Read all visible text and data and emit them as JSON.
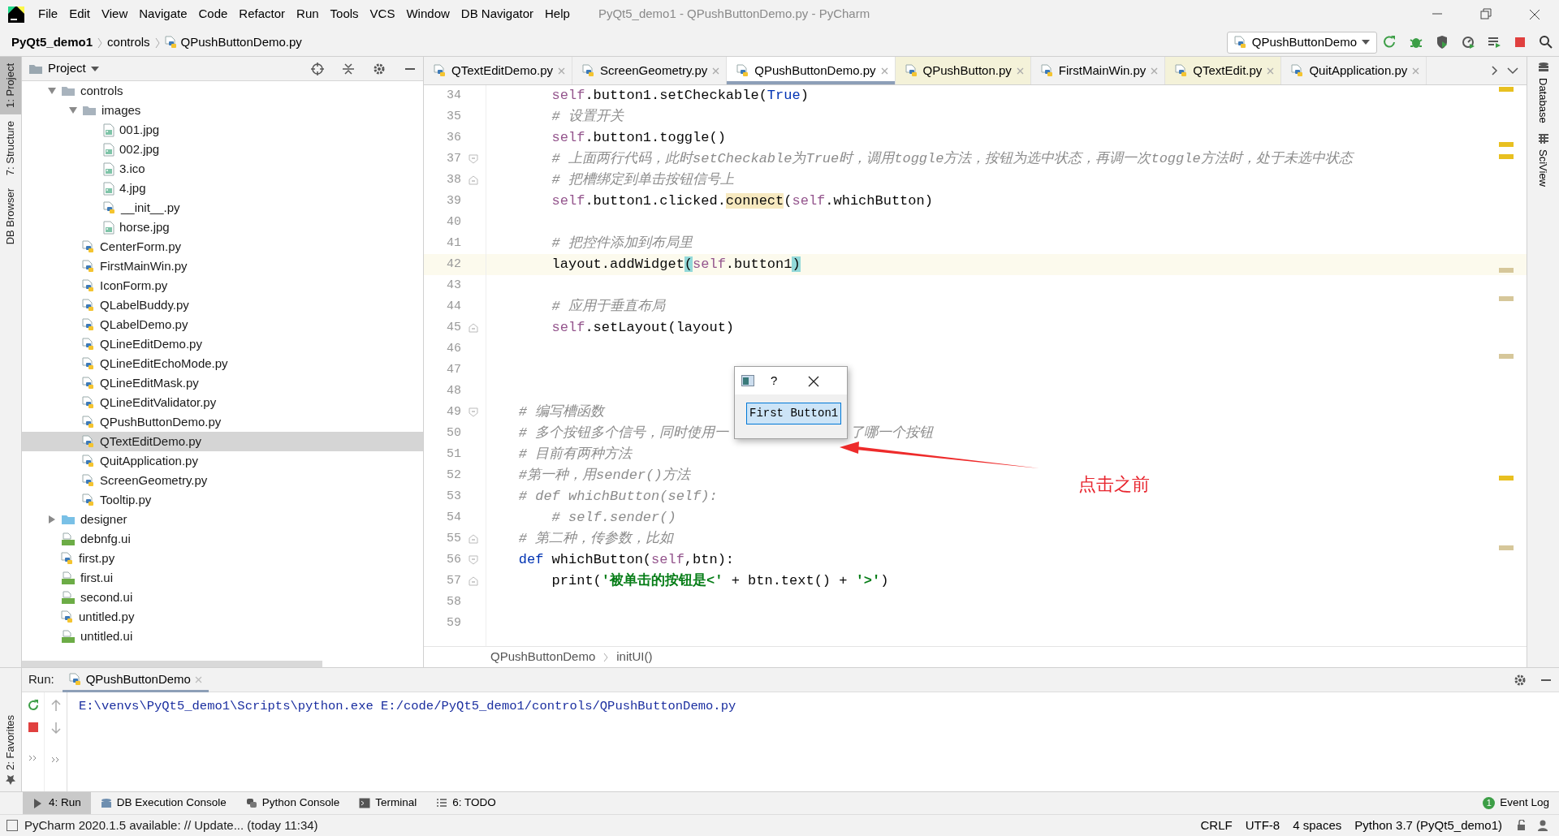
{
  "app_title": "PyQt5_demo1 - QPushButtonDemo.py - PyCharm",
  "menu": [
    "File",
    "Edit",
    "View",
    "Navigate",
    "Code",
    "Refactor",
    "Run",
    "Tools",
    "VCS",
    "Window",
    "DB Navigator",
    "Help"
  ],
  "breadcrumb": [
    "PyQt5_demo1",
    "controls",
    "QPushButtonDemo.py"
  ],
  "run_config": "QPushButtonDemo",
  "left_tool_tabs": [
    {
      "label": "1: Project",
      "selected": true
    },
    {
      "label": "7: Structure",
      "selected": false
    },
    {
      "label": "DB Browser",
      "selected": false
    }
  ],
  "project": {
    "title": "Project",
    "tree": [
      {
        "label": "controls",
        "kind": "folder",
        "expanded": true,
        "selected": false,
        "children": [
          {
            "label": "images",
            "kind": "folder",
            "expanded": true,
            "selected": false,
            "children": [
              {
                "label": "001.jpg",
                "kind": "image",
                "selected": false
              },
              {
                "label": "002.jpg",
                "kind": "image",
                "selected": false
              },
              {
                "label": "3.ico",
                "kind": "image",
                "selected": false
              },
              {
                "label": "4.jpg",
                "kind": "image",
                "selected": false
              },
              {
                "label": "__init__.py",
                "kind": "python",
                "selected": false
              },
              {
                "label": "horse.jpg",
                "kind": "image",
                "selected": false
              }
            ]
          },
          {
            "label": "CenterForm.py",
            "kind": "python",
            "selected": false
          },
          {
            "label": "FirstMainWin.py",
            "kind": "python",
            "selected": false
          },
          {
            "label": "IconForm.py",
            "kind": "python",
            "selected": false
          },
          {
            "label": "QLabelBuddy.py",
            "kind": "python",
            "selected": false
          },
          {
            "label": "QLabelDemo.py",
            "kind": "python",
            "selected": false
          },
          {
            "label": "QLineEditDemo.py",
            "kind": "python",
            "selected": false
          },
          {
            "label": "QLineEditEchoMode.py",
            "kind": "python",
            "selected": false
          },
          {
            "label": "QLineEditMask.py",
            "kind": "python",
            "selected": false
          },
          {
            "label": "QLineEditValidator.py",
            "kind": "python",
            "selected": false
          },
          {
            "label": "QPushButtonDemo.py",
            "kind": "python",
            "selected": false
          },
          {
            "label": "QTextEditDemo.py",
            "kind": "python",
            "selected": true
          },
          {
            "label": "QuitApplication.py",
            "kind": "python",
            "selected": false
          },
          {
            "label": "ScreenGeometry.py",
            "kind": "python",
            "selected": false
          },
          {
            "label": "Tooltip.py",
            "kind": "python",
            "selected": false
          }
        ]
      },
      {
        "label": "designer",
        "kind": "source-folder",
        "expanded": false,
        "selected": false
      },
      {
        "label": "debnfg.ui",
        "kind": "qt",
        "selected": false
      },
      {
        "label": "first.py",
        "kind": "python",
        "selected": false
      },
      {
        "label": "first.ui",
        "kind": "qt",
        "selected": false
      },
      {
        "label": "second.ui",
        "kind": "qt",
        "selected": false
      },
      {
        "label": "untitled.py",
        "kind": "python",
        "selected": false
      },
      {
        "label": "untitled.ui",
        "kind": "qt",
        "selected": false
      }
    ]
  },
  "editor_tabs": [
    {
      "label": "QTextEditDemo.py",
      "selected": false,
      "color": "#f2f2f2"
    },
    {
      "label": "ScreenGeometry.py",
      "selected": false,
      "color": "#f2f2f2"
    },
    {
      "label": "QPushButtonDemo.py",
      "selected": true,
      "color": "#ffffff"
    },
    {
      "label": "QPushButton.py",
      "selected": false,
      "color": "#f4f2d9"
    },
    {
      "label": "FirstMainWin.py",
      "selected": false,
      "color": "#f2f2f2"
    },
    {
      "label": "QTextEdit.py",
      "selected": false,
      "color": "#f4f2d9"
    },
    {
      "label": "QuitApplication.py",
      "selected": false,
      "color": "#f2f2f2"
    }
  ],
  "right_tool_tabs": [
    "Database",
    "SciView"
  ],
  "code_lines": [
    {
      "number": "34",
      "current": false,
      "segments": [
        {
          "text": "        self",
          "kind": "self"
        },
        {
          "text": ".button1.setCheckable(",
          "kind": "text"
        },
        {
          "text": "True",
          "kind": "keyword"
        },
        {
          "text": ")",
          "kind": "text"
        }
      ]
    },
    {
      "number": "35",
      "current": false,
      "segments": [
        {
          "text": "        # 设置开关",
          "kind": "comment"
        }
      ]
    },
    {
      "number": "36",
      "current": false,
      "segments": [
        {
          "text": "        self",
          "kind": "self"
        },
        {
          "text": ".button1.toggle()",
          "kind": "text"
        }
      ]
    },
    {
      "number": "37",
      "current": false,
      "fold_start": true,
      "segments": [
        {
          "text": "        # 上面两行代码，此时setCheckable为True时，调用toggle方法，按钮为选中状态，再调一次toggle方法时，处于未选中状态",
          "kind": "comment"
        }
      ]
    },
    {
      "number": "38",
      "current": false,
      "fold_end": true,
      "segments": [
        {
          "text": "        # 把槽绑定到单击按钮信号上",
          "kind": "comment"
        }
      ]
    },
    {
      "number": "39",
      "current": false,
      "segments": [
        {
          "text": "        self",
          "kind": "self"
        },
        {
          "text": ".button1.clicked.",
          "kind": "text"
        },
        {
          "text": "connect",
          "kind": "usage"
        },
        {
          "text": "(",
          "kind": "text"
        },
        {
          "text": "self",
          "kind": "self"
        },
        {
          "text": ".whichButton)",
          "kind": "text"
        }
      ]
    },
    {
      "number": "40",
      "current": false
    },
    {
      "number": "41",
      "current": false,
      "segments": [
        {
          "text": "        # 把控件添加到布局里",
          "kind": "comment"
        }
      ]
    },
    {
      "number": "42",
      "current": true,
      "segments": [
        {
          "text": "        layout.addWidget",
          "kind": "text"
        },
        {
          "text": "(",
          "kind": "match"
        },
        {
          "text": "self",
          "kind": "self"
        },
        {
          "text": ".button1",
          "kind": "text"
        },
        {
          "text": ")",
          "kind": "match"
        }
      ]
    },
    {
      "number": "43",
      "current": false
    },
    {
      "number": "44",
      "current": false,
      "segments": [
        {
          "text": "        # 应用于垂直布局",
          "kind": "comment"
        }
      ]
    },
    {
      "number": "45",
      "current": false,
      "fold_end": true,
      "segments": [
        {
          "text": "        self",
          "kind": "self"
        },
        {
          "text": ".setLayout(layout)",
          "kind": "text"
        }
      ]
    },
    {
      "number": "46",
      "current": false
    },
    {
      "number": "47",
      "current": false
    },
    {
      "number": "48",
      "current": false
    },
    {
      "number": "49",
      "current": false,
      "fold_start": true,
      "segments": [
        {
          "text": "    # 编写槽函数",
          "kind": "comment"
        }
      ]
    },
    {
      "number": "50",
      "current": false,
      "segments": [
        {
          "text": "    # 多个按钮多个信号，同时使用一",
          "kind": "comment"
        },
        {
          "text": "了哪一个按钮",
          "kind": "comment",
          "after_dialog": true
        }
      ]
    },
    {
      "number": "51",
      "current": false,
      "segments": [
        {
          "text": "    # 目前有两种方法",
          "kind": "comment"
        }
      ]
    },
    {
      "number": "52",
      "current": false,
      "segments": [
        {
          "text": "    #第一种，用sender()方法",
          "kind": "comment"
        }
      ]
    },
    {
      "number": "53",
      "current": false,
      "segments": [
        {
          "text": "    # def whichButton(self):",
          "kind": "comment"
        }
      ]
    },
    {
      "number": "54",
      "current": false,
      "segments": [
        {
          "text": "        # self.sender()",
          "kind": "comment"
        }
      ]
    },
    {
      "number": "55",
      "current": false,
      "fold_end": true,
      "segments": [
        {
          "text": "    # 第二种，传参数，比如",
          "kind": "comment"
        }
      ]
    },
    {
      "number": "56",
      "current": false,
      "fold_start": true,
      "segments": [
        {
          "text": "    def",
          "kind": "keyword"
        },
        {
          "text": " whichButton(",
          "kind": "text"
        },
        {
          "text": "self",
          "kind": "self"
        },
        {
          "text": ",btn):",
          "kind": "text"
        }
      ]
    },
    {
      "number": "57",
      "current": false,
      "fold_end": true,
      "segments": [
        {
          "text": "        print(",
          "kind": "text"
        },
        {
          "text": "'被单击的按钮是<'",
          "kind": "string"
        },
        {
          "text": " + btn.text() + ",
          "kind": "text"
        },
        {
          "text": "'>'",
          "kind": "string"
        },
        {
          "text": ")",
          "kind": "text"
        }
      ]
    },
    {
      "number": "58",
      "current": false
    },
    {
      "number": "59",
      "current": false
    }
  ],
  "editor_breadcrumb": [
    "QPushButtonDemo",
    "initUI()"
  ],
  "dialog": {
    "help": "?",
    "button": "First Button1"
  },
  "annotation": "点击之前",
  "run_panel": {
    "label": "Run:",
    "tab": "QPushButtonDemo",
    "output": "E:\\venvs\\PyQt5_demo1\\Scripts\\python.exe E:/code/PyQt5_demo1/controls/QPushButtonDemo.py"
  },
  "favorites_tab": "2: Favorites",
  "bottom_tabs": [
    {
      "label": "4: Run",
      "selected": true
    },
    {
      "label": "DB Execution Console",
      "selected": false
    },
    {
      "label": "Python Console",
      "selected": false
    },
    {
      "label": "Terminal",
      "selected": false
    },
    {
      "label": "6: TODO",
      "selected": false
    }
  ],
  "event_log": {
    "count": "1",
    "label": "Event Log"
  },
  "status": {
    "message": "PyCharm 2020.1.5 available: // Update... (today 11:34)",
    "items": [
      "CRLF",
      "UTF-8",
      "4 spaces",
      "Python 3.7 (PyQt5_demo1)"
    ]
  }
}
